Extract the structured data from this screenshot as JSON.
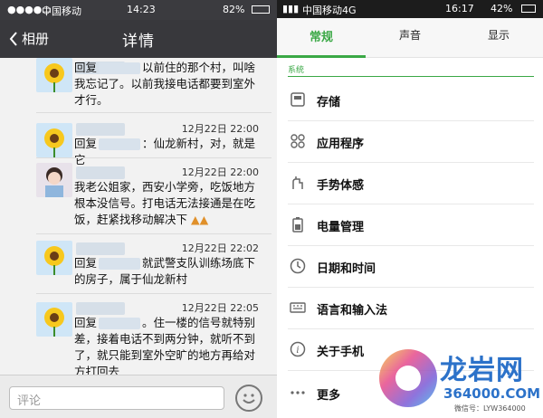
{
  "left_screen": {
    "status": {
      "carrier": "中国移动",
      "time": "14:23",
      "battery": "82%"
    },
    "nav": {
      "back_label": "相册",
      "title": "详情"
    },
    "comments": [
      {
        "time": "",
        "text_before": "回复",
        "text_after": "以前住的那个村，叫啥我忘记了。以前我接电话都要到室外才行。"
      },
      {
        "time": "12月22日 22:00",
        "text_before": "回复",
        "text_after": "：仙龙新村，对，就是它"
      },
      {
        "time": "12月22日 22:00",
        "text_before": "",
        "text_after": "我老公姐家，西安小学旁，吃饭地方根本没信号。打电话无法接通是在吃饭，赶紧找移动解决下"
      },
      {
        "time": "12月22日 22:02",
        "text_before": "回复",
        "text_after": "就武警支队训练场底下的房子，属于仙龙新村"
      },
      {
        "time": "12月22日 22:05",
        "text_before": "回复",
        "text_after": "。住一楼的信号就特别差，接着电话不到两分钟，就听不到了，就只能到室外空旷的地方再给对方打回去"
      }
    ],
    "input": {
      "placeholder": "评论"
    }
  },
  "right_screen": {
    "status": {
      "carrier": "中国移动4G",
      "time": "16:17",
      "battery": "42%"
    },
    "tabs": [
      {
        "label": "常规"
      },
      {
        "label": "声音"
      },
      {
        "label": "显示"
      }
    ],
    "section_label": "系统",
    "settings": [
      {
        "label": "存储",
        "icon": "storage-icon"
      },
      {
        "label": "应用程序",
        "icon": "apps-icon"
      },
      {
        "label": "手势体感",
        "icon": "gesture-icon"
      },
      {
        "label": "电量管理",
        "icon": "battery-icon"
      },
      {
        "label": "日期和时间",
        "icon": "clock-icon"
      },
      {
        "label": "语言和输入法",
        "icon": "keyboard-icon"
      },
      {
        "label": "关于手机",
        "icon": "info-icon"
      },
      {
        "label": "更多",
        "icon": "more-icon"
      }
    ]
  },
  "watermark": {
    "name": "龙岩网",
    "domain": "364000.COM",
    "wechat": "微信号：LYW364000"
  },
  "colors": {
    "accent_green": "#3aa845",
    "nav_dark": "#38383c",
    "watermark_blue": "#2c72c9"
  }
}
